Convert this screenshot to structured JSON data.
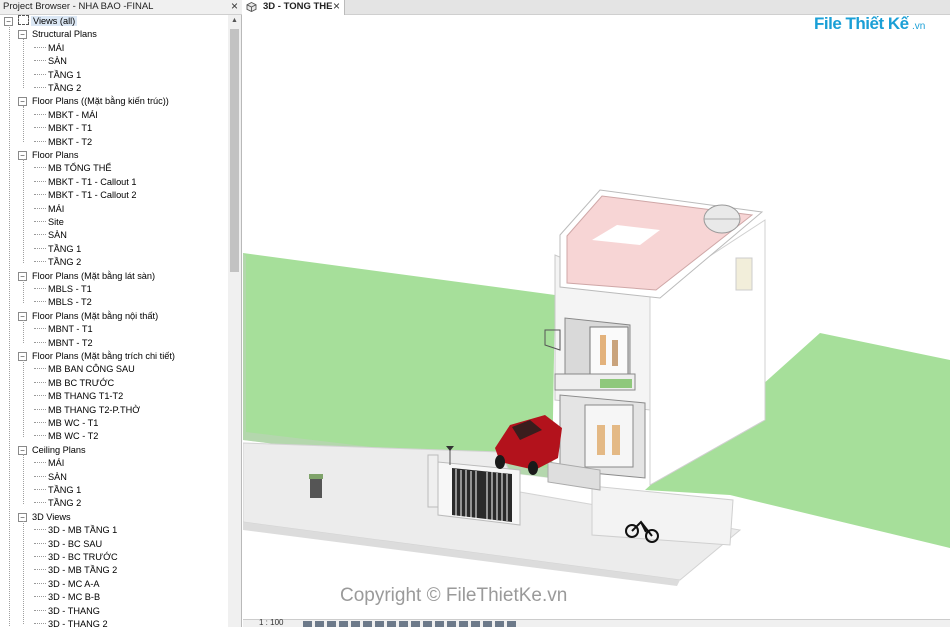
{
  "browser": {
    "title": "Project Browser - NHA BAO -FINAL",
    "close": "×",
    "root_label": "Views (all)",
    "groups": [
      {
        "label": "Structural Plans",
        "items": [
          "MÁI",
          "SÀN",
          "TẦNG 1",
          "TẦNG 2"
        ]
      },
      {
        "label": "Floor Plans ((Mặt bằng kiến trúc))",
        "items": [
          "MBKT - MÁI",
          "MBKT - T1",
          "MBKT - T2"
        ]
      },
      {
        "label": "Floor Plans",
        "items": [
          "MB TỔNG THỂ",
          "MBKT - T1 - Callout 1",
          "MBKT - T1 - Callout 2",
          "MÁI",
          "Site",
          "SÀN",
          "TẦNG 1",
          "TẦNG 2"
        ]
      },
      {
        "label": "Floor Plans (Mặt bằng lát sàn)",
        "items": [
          "MBLS - T1",
          "MBLS - T2"
        ]
      },
      {
        "label": "Floor Plans (Mặt bằng nội thất)",
        "items": [
          "MBNT - T1",
          "MBNT - T2"
        ]
      },
      {
        "label": "Floor Plans (Mặt bằng trích chi tiết)",
        "items": [
          "MB BAN CÔNG SAU",
          "MB BC TRƯỚC",
          "MB THANG  T1-T2",
          "MB THANG  T2-P.THỜ",
          "MB WC - T1",
          "MB WC - T2"
        ]
      },
      {
        "label": "Ceiling Plans",
        "items": [
          "MÁI",
          "SÀN",
          "TẦNG 1",
          "TẦNG 2"
        ]
      },
      {
        "label": "3D Views",
        "items": [
          "3D -  MB TẦNG 1",
          "3D - BC SAU",
          "3D - BC TRƯỚC",
          "3D - MB TẦNG 2",
          "3D - MC A-A",
          "3D - MC B-B",
          "3D - THANG",
          "3D - THANG 2"
        ]
      }
    ]
  },
  "tab": {
    "label": "3D - TONG THE",
    "close": "×"
  },
  "logo": {
    "brand": "File Thiết Kế",
    "suffix": ".vn"
  },
  "watermark": "Copyright © FileThietKe.vn",
  "status": {
    "scale": "1 : 100"
  },
  "colors": {
    "grass": "#a6df9a",
    "roof_pink": "#f7d5d5",
    "car": "#b3121c",
    "road": "#e6e6e6",
    "brand": "#1a9fd6"
  }
}
